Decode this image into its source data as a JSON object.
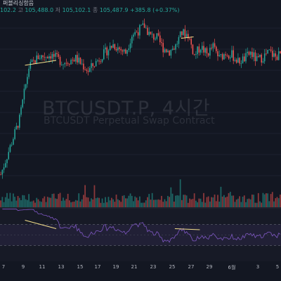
{
  "header": {
    "title_fragment": "퍼블리싱함음",
    "ohlc_text": {
      "o_label": "",
      "o_value": "102.2",
      "h_label": "고",
      "h_value": "105,488.0",
      "l_label": "저",
      "l_value": "105,102.1",
      "c_label": "종",
      "c_value": "105,487.9",
      "change": "+385.8 (+0.37%)"
    }
  },
  "watermark": {
    "symbol": "BTCUSDT.P, 4시간",
    "description": "BTCUSDT Perpetual Swap Contract"
  },
  "x_axis": {
    "labels": [
      "7",
      "9",
      "11",
      "13",
      "15",
      "17",
      "19",
      "21",
      "23",
      "25",
      "27",
      "29",
      "6월",
      "3",
      "5"
    ]
  },
  "colors": {
    "background": "#131722",
    "up": "#26a69a",
    "down": "#ef5350",
    "rsi_line": "#7e57c2",
    "trendline": "#f5e08c"
  },
  "chart_data": {
    "type": "candlestick",
    "title": "",
    "price_trend": [
      [
        0,
        84000
      ],
      [
        3,
        88000
      ],
      [
        6,
        92000
      ],
      [
        9,
        99500
      ],
      [
        12,
        101000
      ],
      [
        16,
        101300
      ],
      [
        20,
        100200
      ],
      [
        24,
        100800
      ],
      [
        28,
        99000
      ],
      [
        32,
        101000
      ],
      [
        36,
        102800
      ],
      [
        40,
        101600
      ],
      [
        42,
        104200
      ],
      [
        44,
        104800
      ],
      [
        46,
        105500
      ],
      [
        48,
        104000
      ],
      [
        50,
        103800
      ],
      [
        52,
        102300
      ],
      [
        54,
        101800
      ],
      [
        56,
        102600
      ],
      [
        58,
        104500
      ],
      [
        60,
        104200
      ],
      [
        62,
        101200
      ],
      [
        64,
        102500
      ],
      [
        66,
        101400
      ],
      [
        68,
        102500
      ],
      [
        70,
        100800
      ],
      [
        72,
        101600
      ],
      [
        74,
        101300
      ],
      [
        76,
        100300
      ],
      [
        78,
        100700
      ],
      [
        80,
        101600
      ],
      [
        82,
        100500
      ],
      [
        84,
        101000
      ],
      [
        86,
        101700
      ],
      [
        88,
        101000
      ],
      [
        90,
        101500
      ]
    ],
    "volume_series": "bars per candle, colored by candle direction",
    "rsi_levels": [
      70,
      30
    ],
    "trendlines": [
      {
        "pane": "price",
        "from": [
          8,
          99800
        ],
        "to": [
          18,
          100500
        ]
      },
      {
        "pane": "price",
        "from": [
          58,
          103700
        ],
        "to": [
          62,
          103900
        ]
      },
      {
        "pane": "rsi",
        "from": [
          8,
          78
        ],
        "to": [
          18,
          62
        ]
      },
      {
        "pane": "rsi",
        "from": [
          56,
          62
        ],
        "to": [
          64,
          60
        ]
      }
    ]
  }
}
